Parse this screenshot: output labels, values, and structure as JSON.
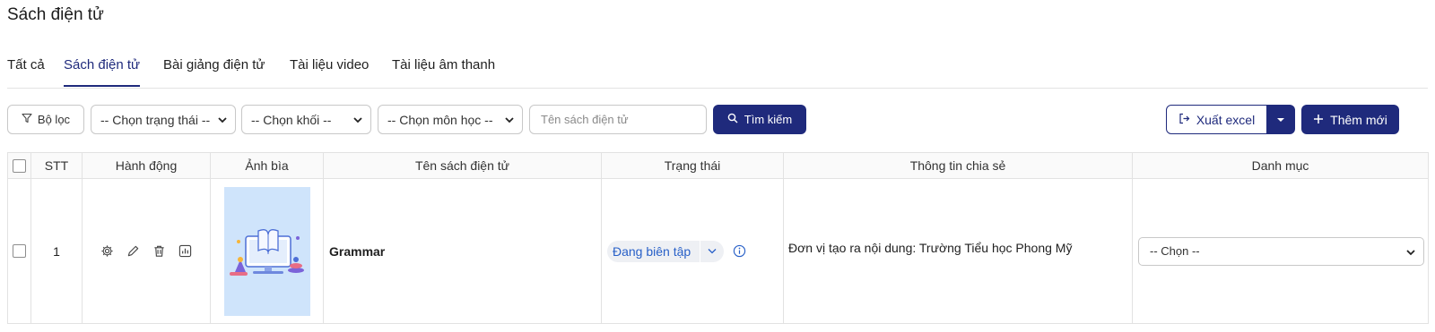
{
  "page_title": "Sách điện tử",
  "tabs": [
    {
      "label": "Tất cả",
      "active": false
    },
    {
      "label": "Sách điện tử",
      "active": true
    },
    {
      "label": "Bài giảng điện tử",
      "active": false
    },
    {
      "label": "Tài liệu video",
      "active": false
    },
    {
      "label": "Tài liệu âm thanh",
      "active": false
    }
  ],
  "toolbar": {
    "filter_label": "Bộ lọc",
    "status_select": "-- Chọn trạng thái --",
    "grade_select": "-- Chọn khối --",
    "subject_select": "-- Chọn môn học --",
    "search_placeholder": "Tên sách điện tử",
    "search_label": "Tìm kiếm",
    "export_label": "Xuất excel",
    "add_label": "Thêm mới"
  },
  "table": {
    "columns": [
      "STT",
      "Hành động",
      "Ảnh bìa",
      "Tên sách điện tử",
      "Trạng thái",
      "Thông tin chia sẻ",
      "Danh mục"
    ],
    "rows": [
      {
        "stt": "1",
        "name": "Grammar",
        "status": "Đang biên tập",
        "share_info": "Đơn vị tạo ra nội dung: Trường Tiểu học Phong Mỹ",
        "category": "-- Chọn --"
      }
    ]
  },
  "colors": {
    "primary": "#1f2a7c",
    "status_text": "#2860c8",
    "cover_bg": "#cfe4fb"
  }
}
